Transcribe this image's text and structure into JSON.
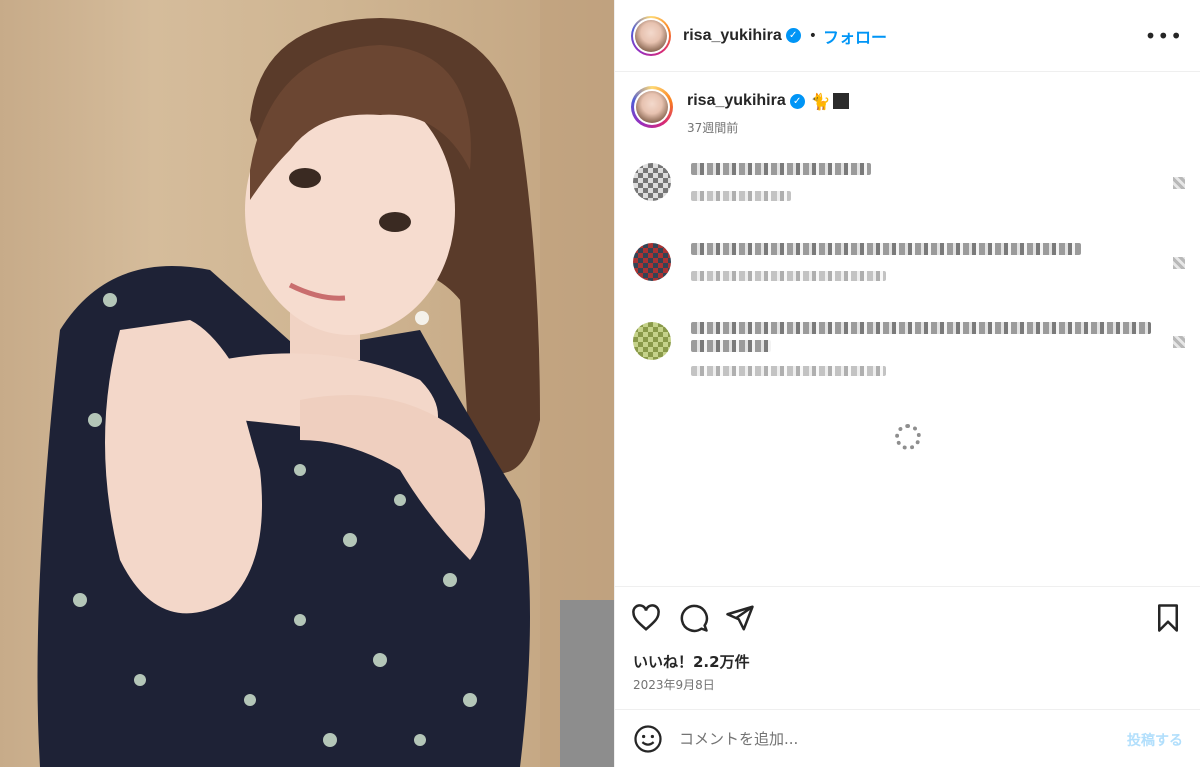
{
  "header": {
    "username": "risa_yukihira",
    "verified_glyph": "✓",
    "separator": "•",
    "follow_label": "フォロー",
    "more_glyph": "•••"
  },
  "caption": {
    "username": "risa_yukihira",
    "emoji": "🐈",
    "time_ago": "37週間前"
  },
  "comments": [
    {
      "pixelated": true
    },
    {
      "pixelated": true
    },
    {
      "pixelated": true
    }
  ],
  "actions": {
    "icons": [
      "heart-icon",
      "comment-icon",
      "share-icon",
      "bookmark-icon"
    ]
  },
  "likes_text": "いいね！2.2万件",
  "date_text": "2023年9月8日",
  "compose": {
    "placeholder": "コメントを追加...",
    "post_label": "投稿する"
  },
  "colors": {
    "accent": "#0095f6",
    "text": "#262626",
    "muted": "#737373",
    "post_disabled": "#b2dffc"
  }
}
